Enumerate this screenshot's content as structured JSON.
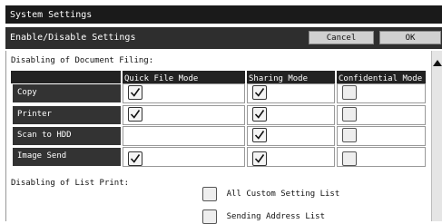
{
  "window": {
    "title": "System Settings"
  },
  "header": {
    "title": "Enable/Disable Settings",
    "cancel_label": "Cancel",
    "ok_label": "OK"
  },
  "document_filing": {
    "label": "Disabling of Document Filing:",
    "columns": [
      "Quick File Mode",
      "Sharing Mode",
      "Confidential Mode"
    ],
    "rows": [
      {
        "label": "Copy",
        "values": [
          true,
          true,
          false
        ]
      },
      {
        "label": "Printer",
        "values": [
          true,
          true,
          false
        ]
      },
      {
        "label": "Scan to HDD",
        "values": [
          null,
          true,
          false
        ]
      },
      {
        "label": "Image Send",
        "values": [
          true,
          true,
          false
        ]
      }
    ]
  },
  "list_print": {
    "label": "Disabling of List Print:",
    "items": [
      {
        "label": "All Custom Setting List",
        "checked": false
      },
      {
        "label": "Sending Address List",
        "checked": false
      }
    ]
  }
}
